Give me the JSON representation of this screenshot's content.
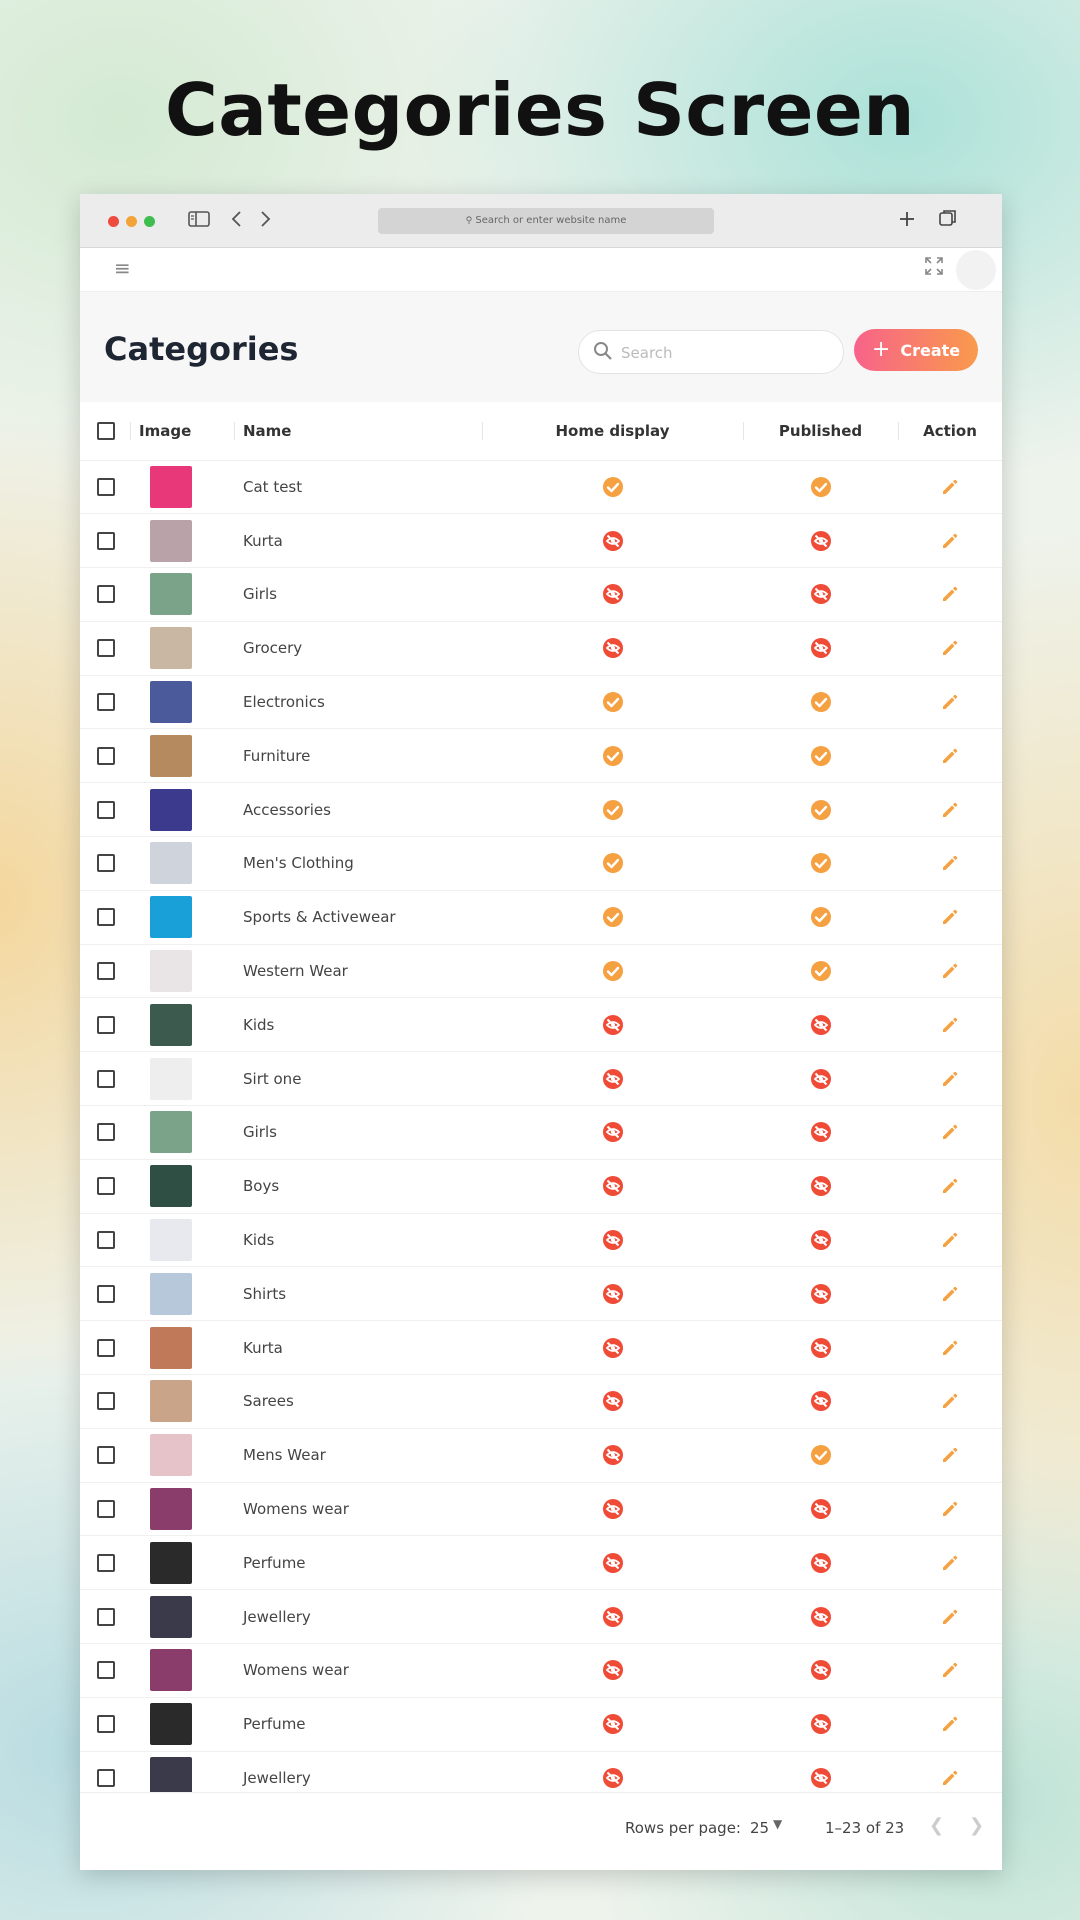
{
  "hero_title": "Categories Screen",
  "browser": {
    "address_placeholder": "Search or enter website name"
  },
  "page": {
    "title": "Categories",
    "search_placeholder": "Search",
    "create_label": "Create"
  },
  "table": {
    "columns": {
      "image": "Image",
      "name": "Name",
      "home_display": "Home display",
      "published": "Published",
      "action": "Action"
    },
    "rows": [
      {
        "name": "Cat test",
        "home_display": true,
        "published": true,
        "thumb_color": "#e8387a"
      },
      {
        "name": "Kurta",
        "home_display": false,
        "published": false,
        "thumb_color": "#b9a3a8"
      },
      {
        "name": "Girls",
        "home_display": false,
        "published": false,
        "thumb_color": "#7aa38a"
      },
      {
        "name": "Grocery",
        "home_display": false,
        "published": false,
        "thumb_color": "#c9b7a4"
      },
      {
        "name": "Electronics",
        "home_display": true,
        "published": true,
        "thumb_color": "#4a5a9a"
      },
      {
        "name": "Furniture",
        "home_display": true,
        "published": true,
        "thumb_color": "#b58a5e"
      },
      {
        "name": "Accessories",
        "home_display": true,
        "published": true,
        "thumb_color": "#3b3a8c"
      },
      {
        "name": "Men's Clothing",
        "home_display": true,
        "published": true,
        "thumb_color": "#cfd4dc"
      },
      {
        "name": "Sports & Activewear",
        "home_display": true,
        "published": true,
        "thumb_color": "#1aa0d8"
      },
      {
        "name": "Western Wear",
        "home_display": true,
        "published": true,
        "thumb_color": "#e9e4e6"
      },
      {
        "name": "Kids",
        "home_display": false,
        "published": false,
        "thumb_color": "#3d5a4e"
      },
      {
        "name": "Sirt one",
        "home_display": false,
        "published": false,
        "thumb_color": "#eeeeee"
      },
      {
        "name": "Girls",
        "home_display": false,
        "published": false,
        "thumb_color": "#7aa38a"
      },
      {
        "name": "Boys",
        "home_display": false,
        "published": false,
        "thumb_color": "#2f4f44"
      },
      {
        "name": "Kids",
        "home_display": false,
        "published": false,
        "thumb_color": "#e7e9ee"
      },
      {
        "name": "Shirts",
        "home_display": false,
        "published": false,
        "thumb_color": "#b7c8da"
      },
      {
        "name": "Kurta",
        "home_display": false,
        "published": false,
        "thumb_color": "#c07a5a"
      },
      {
        "name": "Sarees",
        "home_display": false,
        "published": false,
        "thumb_color": "#c9a488"
      },
      {
        "name": "Mens Wear",
        "home_display": false,
        "published": true,
        "thumb_color": "#e6c3c8"
      },
      {
        "name": "Womens wear",
        "home_display": false,
        "published": false,
        "thumb_color": "#8a3c6a"
      },
      {
        "name": "Perfume",
        "home_display": false,
        "published": false,
        "thumb_color": "#2a2a2a"
      },
      {
        "name": "Jewellery",
        "home_display": false,
        "published": false,
        "thumb_color": "#3a3a4a"
      },
      {
        "name": "Womens wear",
        "home_display": false,
        "published": false,
        "thumb_color": "#8a3c6a"
      },
      {
        "name": "Perfume",
        "home_display": false,
        "published": false,
        "thumb_color": "#2a2a2a"
      },
      {
        "name": "Jewellery",
        "home_display": false,
        "published": false,
        "thumb_color": "#3a3a4a"
      }
    ]
  },
  "pagination": {
    "rows_per_page_label": "Rows per page:",
    "rows_per_page_value": "25",
    "range_text": "1–23 of 23"
  },
  "colors": {
    "check_orange": "#f5a142",
    "hidden_red": "#ef4b36",
    "edit_orange": "#f5a142",
    "create_gradient_start": "#f8638a",
    "create_gradient_end": "#f99a4c"
  }
}
